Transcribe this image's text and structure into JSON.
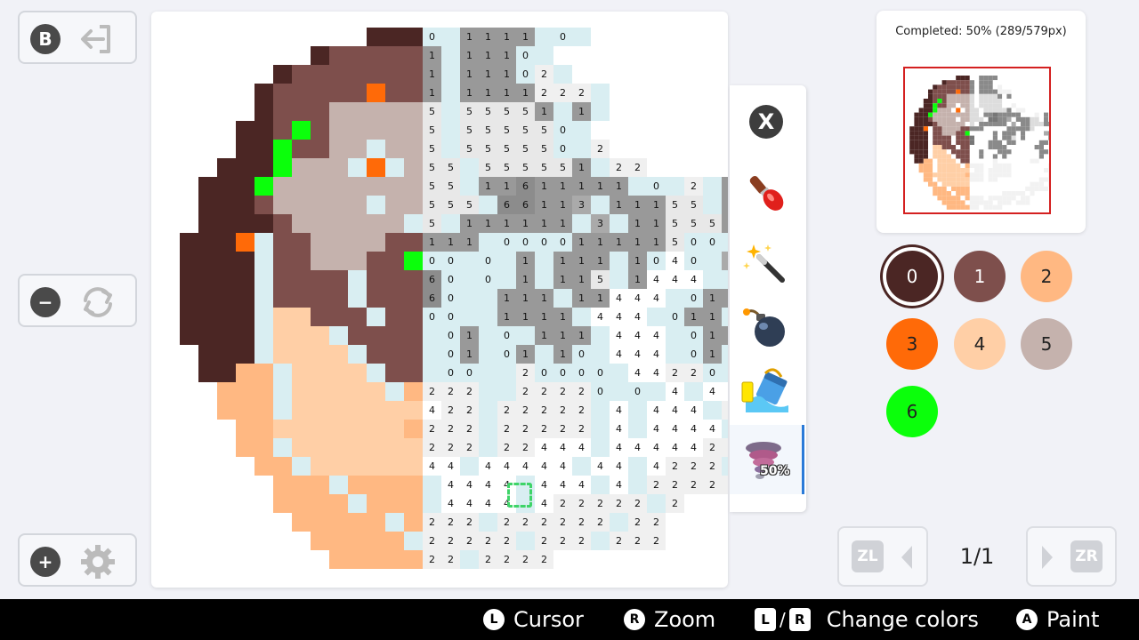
{
  "colors": {
    "0": "#4b2624",
    "1": "#7e4f4c",
    "2": "#ffb882",
    "3": "#ff6a08",
    "4": "#ffcfa6",
    "5": "#c5b2ad",
    "6": "#0bff0b"
  },
  "side_buttons": {
    "back": {
      "badge": "B",
      "icon": "exit-icon"
    },
    "zoom_out": {
      "badge": "−",
      "icon": "reset-view-icon"
    },
    "zoom_in": {
      "badge": "+",
      "icon": "gear-icon"
    }
  },
  "tools": [
    {
      "name": "close",
      "label": "X"
    },
    {
      "name": "brush",
      "label": ""
    },
    {
      "name": "magic-wand",
      "label": ""
    },
    {
      "name": "bomb",
      "label": ""
    },
    {
      "name": "paint-bucket",
      "label": ""
    },
    {
      "name": "tornado",
      "label": "50%"
    }
  ],
  "preview": {
    "completed_text": "Completed: 50% (289/579px)"
  },
  "palette": [
    {
      "num": "0",
      "color": "#4b2624",
      "text_color": "#ffffff",
      "selected": true
    },
    {
      "num": "1",
      "color": "#7e4f4c",
      "text_color": "#ffffff",
      "selected": false
    },
    {
      "num": "2",
      "color": "#ffb882",
      "text_color": "#222222",
      "selected": false
    },
    {
      "num": "3",
      "color": "#ff6a08",
      "text_color": "#222222",
      "selected": false
    },
    {
      "num": "4",
      "color": "#ffcfa6",
      "text_color": "#222222",
      "selected": false
    },
    {
      "num": "5",
      "color": "#c5b2ad",
      "text_color": "#222222",
      "selected": false
    },
    {
      "num": "6",
      "color": "#0bff0b",
      "text_color": "#222222",
      "selected": false
    }
  ],
  "pager": {
    "left_badge": "ZL",
    "right_badge": "ZR",
    "page": "1/1"
  },
  "footer": {
    "cursor": {
      "key": "L",
      "label": "Cursor"
    },
    "zoom": {
      "key": "R",
      "label": "Zoom"
    },
    "change": {
      "key_l": "L",
      "key_r": "R",
      "label": "Change colors"
    },
    "paint": {
      "key": "A",
      "label": "Paint"
    }
  },
  "grid_rows": [
    "...........0000 1111 0 ",
    "........0111111 1110 ",
    "......011111111 11102 ",
    ".....0111113111 1111222 ",
    ".....0111555555 55551 1 ",
    "....00161555555 555550 ",
    "....0061155 555 555550 2",
    "...0006555 3 555 555551 22",
    "..00065555555555 11611111 0 2 1 0",
    "..000155555 55555 66113 11155 1 2 0",
    "..00001555555 5 111111 3 1155511 1 1 1 0",
    ".0003 11555511111 0000111115000 1310",
    ".0000 1155511600 0 1 111 1040 3110",
    ".0000 1111 11160 0 1 115 1444 0110",
    ".0000 1111 11160  111 11444 0110",
    ".0000 44111 1100  1111 444 0110",
    ".0000 444 1111 01 0 111 444 0110",
    "..000 4444 111 01 01 10 444 0100",
    "..0022 4444 11 00  20000 44220 0",
    "...222 44444 2222  22220 0 4 44222",
    "...222 4444444422 22222 4 444 2222",
    "....2244444442222 22222 4 4444 222",
    "....22 4444444222 22444 444442222",
    ".....22 44444444 44444 44 4222 22",
    "......222 2222 4444 444 4 22222 2",
    "......2222 222 4444 422222 2",
    ".......22222 2222 222222 22",
    "........22222 22222 222 222",
    ".........2222222 2222"
  ]
}
